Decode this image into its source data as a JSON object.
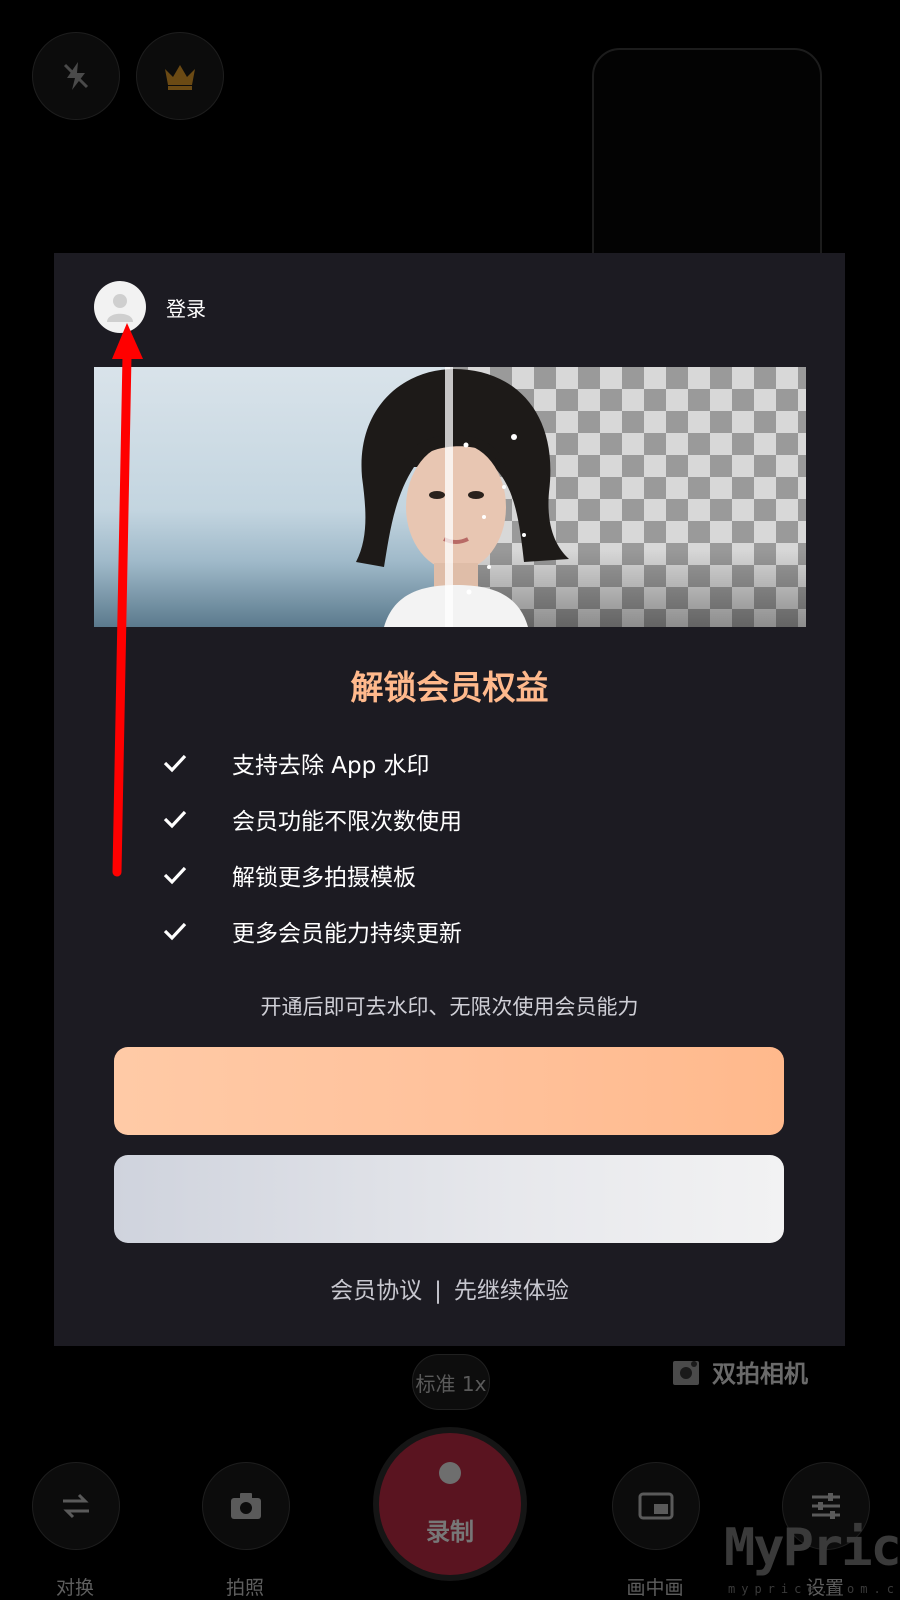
{
  "camera": {
    "zoom_label": "标准 1x",
    "dual_cam_label": "双拍相机",
    "record_label": "录制",
    "bottom_bar": {
      "switch_label": "对换",
      "photo_label": "拍照",
      "pip_label": "画中画",
      "settings_label": "设置"
    },
    "watermark": "MyPrice",
    "watermark_sub": "myprice.com.cn"
  },
  "modal": {
    "login_label": "登录",
    "title": "解锁会员权益",
    "benefits": [
      "支持去除 App 水印",
      "会员功能不限次数使用",
      "解锁更多拍摄模板",
      "更多会员能力持续更新"
    ],
    "note": "开通后即可去水印、无限次使用会员能力",
    "primary_button_label": "",
    "secondary_button_label": "",
    "footer": {
      "agreement_label": "会员协议",
      "separator": "|",
      "continue_label": "先继续体验"
    }
  },
  "colors": {
    "accent_title": "#ffb98c",
    "modal_bg": "#1c1b22",
    "annotation_arrow": "#ff0000"
  }
}
